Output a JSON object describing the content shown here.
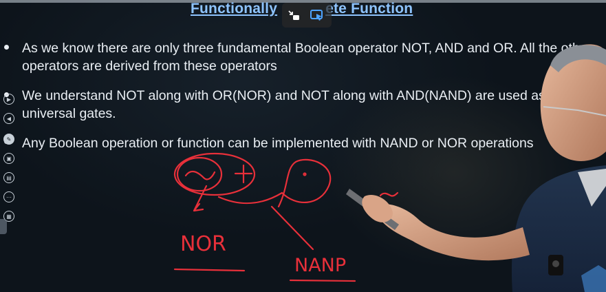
{
  "slide": {
    "title_left": "Functionally",
    "title_right": "ete Function",
    "bullets": [
      "As we know there are only three fundamental Boolean operator NOT, AND and OR. All the other operators are derived from these operators",
      "We understand NOT along with OR(NOR) and NOT along with AND(NAND) are used as universal gates.",
      "Any Boolean operation or function can be implemented with NAND or NOR operations"
    ]
  },
  "overlay": {
    "icons": [
      "collapse-icon",
      "cast-icon"
    ]
  },
  "side_toolbar": {
    "icons": [
      "play-icon",
      "rewind-icon",
      "pen-icon",
      "cast-icon",
      "save-icon",
      "more-icon",
      "screenshot-icon"
    ]
  },
  "annotations": {
    "tilde": "~",
    "plus": "+",
    "tilde_small": "~",
    "nor_label": "NOR",
    "nand_label": "NANP"
  },
  "colors": {
    "ink": "#e8303a",
    "title": "#8ec4ff",
    "text": "#e9eef3"
  }
}
